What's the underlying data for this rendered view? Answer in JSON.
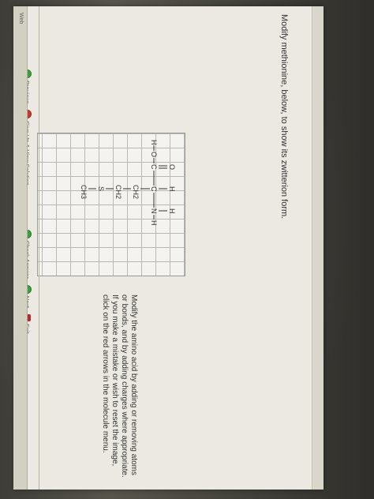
{
  "prompt": "Modify methionine, below, to show its zwitterion form.",
  "instructions": "Modify the amino acid by adding or removing atoms or bonds, and by adding charges where appropriate. If you make a mistake or wish to reset the image, click on the red arrows in the molecule menu.",
  "molecule": {
    "atoms": {
      "o_top": "O",
      "h_top": "H",
      "h_top2": "H",
      "h_left": "H",
      "o_left": "O",
      "c1": "C",
      "c2": "C",
      "n": "N",
      "h_right": "H",
      "ch2_a": "CH2",
      "ch2_b": "CH2",
      "s": "S",
      "ch3": "CH3"
    }
  },
  "toolbar": {
    "previous": "Previous",
    "give_up": "Give Up & View Solution",
    "check_answer": "Check Answer",
    "next": "Next",
    "exit": "Exit"
  },
  "status_bar": {
    "label": "Web"
  }
}
